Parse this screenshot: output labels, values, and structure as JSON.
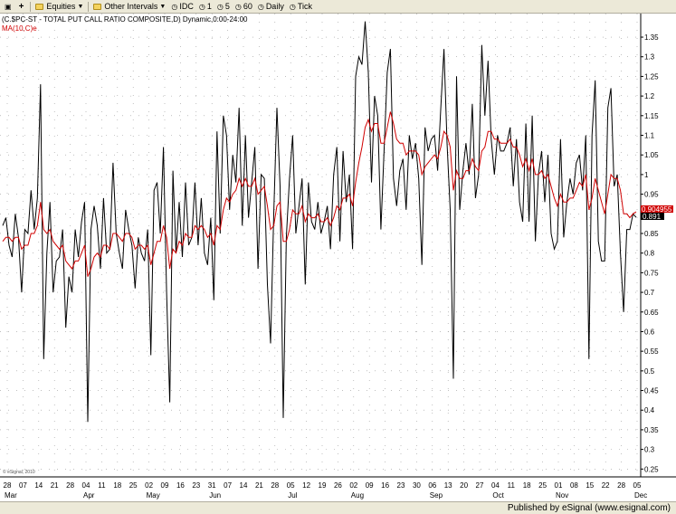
{
  "toolbar": {
    "items": [
      {
        "id": "a",
        "label": ""
      },
      {
        "id": "b",
        "label": ""
      },
      {
        "id": "equities",
        "label": "Equities"
      },
      {
        "id": "intervals",
        "label": "Other Intervals"
      },
      {
        "id": "idc",
        "label": "IDC"
      },
      {
        "id": "i1",
        "label": "1"
      },
      {
        "id": "i5",
        "label": "5"
      },
      {
        "id": "i60",
        "label": "60"
      },
      {
        "id": "daily",
        "label": "Daily"
      },
      {
        "id": "tick",
        "label": "Tick"
      }
    ]
  },
  "chart_data": {
    "type": "line",
    "title": "(C.$PC-ST - TOTAL PUT CALL RATIO COMPOSITE,D) Dynamic,0:00-24:00",
    "legend": "MA(10,C)e",
    "watermark": "© eSignal, 2010",
    "ylim": [
      0.23,
      1.41
    ],
    "yticks": [
      "1.35",
      "1.3",
      "1.25",
      "1.2",
      "1.15",
      "1.1",
      "1.05",
      "1",
      "0.95",
      "0.9",
      "0.85",
      "0.8",
      "0.75",
      "0.7",
      "0.65",
      "0.6",
      "0.55",
      "0.5",
      "0.45",
      "0.4",
      "0.35",
      "0.3",
      "0.25"
    ],
    "price_label": "0.891",
    "ma_label": "0.904955",
    "x_day_labels": [
      "28",
      "07",
      "14",
      "21",
      "28",
      "04",
      "11",
      "18",
      "25",
      "02",
      "09",
      "16",
      "23",
      "31",
      "07",
      "14",
      "21",
      "28",
      "05",
      "12",
      "19",
      "26",
      "02",
      "09",
      "16",
      "23",
      "30",
      "06",
      "13",
      "20",
      "27",
      "04",
      "11",
      "18",
      "25",
      "01",
      "08",
      "15",
      "22",
      "28",
      "05"
    ],
    "x_month_labels": [
      "Mar",
      "Apr",
      "May",
      "Jun",
      "Jul",
      "Aug",
      "Sep",
      "Oct",
      "Nov",
      "Dec"
    ],
    "series": [
      {
        "name": "",
        "color": "#000000",
        "values": [
          0.87,
          0.89,
          0.82,
          0.79,
          0.9,
          0.84,
          0.7,
          0.86,
          0.85,
          0.96,
          0.86,
          0.94,
          1.23,
          0.53,
          0.8,
          0.93,
          0.7,
          0.78,
          0.79,
          0.86,
          0.61,
          0.74,
          0.7,
          0.86,
          0.79,
          0.88,
          0.93,
          0.37,
          0.86,
          0.92,
          0.87,
          0.76,
          0.94,
          0.8,
          0.81,
          1.03,
          0.85,
          0.8,
          0.76,
          0.91,
          0.86,
          0.82,
          0.71,
          0.84,
          0.8,
          0.78,
          0.86,
          0.54,
          0.96,
          0.98,
          0.85,
          1.07,
          0.7,
          0.42,
          1.01,
          0.8,
          0.93,
          0.79,
          0.98,
          0.82,
          0.84,
          0.98,
          0.82,
          0.94,
          0.8,
          0.77,
          0.89,
          0.68,
          1.11,
          0.85,
          1.15,
          1.1,
          0.91,
          1.05,
          0.98,
          1.17,
          0.87,
          1.1,
          0.89,
          0.98,
          1.07,
          0.76,
          1.0,
          0.99,
          0.72,
          0.57,
          0.9,
          1.17,
          0.97,
          0.38,
          0.84,
          0.99,
          1.1,
          0.85,
          0.92,
          0.99,
          0.72,
          0.98,
          0.88,
          0.86,
          0.93,
          0.85,
          0.88,
          0.92,
          0.81,
          1.0,
          1.07,
          0.83,
          1.06,
          0.93,
          1.0,
          0.81,
          1.25,
          1.3,
          1.28,
          1.39,
          1.26,
          0.98,
          1.2,
          1.15,
          0.86,
          1.06,
          1.26,
          1.32,
          0.99,
          0.92,
          1.01,
          1.04,
          0.91,
          1.1,
          1.04,
          1.08,
          0.99,
          0.77,
          1.12,
          1.06,
          1.09,
          1.1,
          1.01,
          1.17,
          1.32,
          1.08,
          0.91,
          0.48,
          1.25,
          0.91,
          1.01,
          1.08,
          1.0,
          1.18,
          0.94,
          1.0,
          1.33,
          1.15,
          1.29,
          1.09,
          1.0,
          1.1,
          1.06,
          1.06,
          1.08,
          1.12,
          0.97,
          1.09,
          0.93,
          0.88,
          1.13,
          0.88,
          1.15,
          0.83,
          1.0,
          1.06,
          0.93,
          1.05,
          0.85,
          0.81,
          0.83,
          1.09,
          0.84,
          0.93,
          0.99,
          0.95,
          1.03,
          1.05,
          0.96,
          1.1,
          0.53,
          1.1,
          1.24,
          0.83,
          0.78,
          0.78,
          1.17,
          1.22,
          0.97,
          1.0,
          0.8,
          0.65,
          0.86,
          0.86,
          0.9,
          0.891
        ]
      },
      {
        "name": "MA(10,C)e",
        "color": "#d00000",
        "values": [
          0.83,
          0.84,
          0.84,
          0.83,
          0.84,
          0.84,
          0.81,
          0.82,
          0.82,
          0.85,
          0.85,
          0.87,
          0.93,
          0.86,
          0.85,
          0.86,
          0.83,
          0.82,
          0.81,
          0.82,
          0.78,
          0.77,
          0.76,
          0.78,
          0.78,
          0.8,
          0.82,
          0.74,
          0.76,
          0.79,
          0.8,
          0.79,
          0.82,
          0.82,
          0.81,
          0.85,
          0.85,
          0.84,
          0.83,
          0.85,
          0.85,
          0.84,
          0.81,
          0.82,
          0.82,
          0.81,
          0.82,
          0.77,
          0.8,
          0.83,
          0.83,
          0.87,
          0.84,
          0.76,
          0.81,
          0.8,
          0.83,
          0.82,
          0.85,
          0.84,
          0.84,
          0.87,
          0.86,
          0.87,
          0.86,
          0.84,
          0.85,
          0.82,
          0.87,
          0.86,
          0.91,
          0.94,
          0.93,
          0.95,
          0.96,
          0.99,
          0.97,
          0.99,
          0.97,
          0.97,
          0.99,
          0.95,
          0.96,
          0.97,
          0.92,
          0.86,
          0.87,
          0.92,
          0.93,
          0.83,
          0.83,
          0.86,
          0.91,
          0.9,
          0.9,
          0.92,
          0.88,
          0.9,
          0.89,
          0.89,
          0.9,
          0.88,
          0.88,
          0.89,
          0.87,
          0.89,
          0.92,
          0.91,
          0.94,
          0.94,
          0.95,
          0.92,
          0.98,
          1.03,
          1.07,
          1.12,
          1.14,
          1.11,
          1.13,
          1.13,
          1.08,
          1.08,
          1.12,
          1.16,
          1.13,
          1.09,
          1.08,
          1.08,
          1.05,
          1.06,
          1.06,
          1.06,
          1.05,
          1.0,
          1.02,
          1.03,
          1.04,
          1.05,
          1.04,
          1.07,
          1.11,
          1.1,
          1.07,
          0.96,
          1.01,
          0.99,
          0.99,
          1.01,
          1.01,
          1.04,
          1.02,
          1.01,
          1.06,
          1.07,
          1.11,
          1.11,
          1.09,
          1.09,
          1.08,
          1.08,
          1.08,
          1.09,
          1.07,
          1.07,
          1.05,
          1.02,
          1.04,
          1.01,
          1.04,
          1.0,
          1.0,
          1.01,
          0.99,
          1.0,
          0.97,
          0.94,
          0.92,
          0.95,
          0.93,
          0.93,
          0.94,
          0.94,
          0.96,
          0.98,
          0.97,
          1.0,
          0.91,
          0.94,
          0.99,
          0.96,
          0.93,
          0.9,
          0.95,
          1.0,
          0.99,
          0.99,
          0.96,
          0.9,
          0.9,
          0.89,
          0.9,
          0.905
        ]
      }
    ]
  }
}
